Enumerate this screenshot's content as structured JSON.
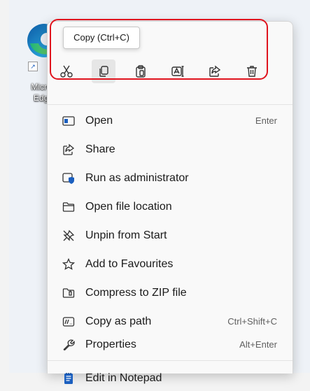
{
  "desktop": {
    "shortcut_label_line1": "Micros",
    "shortcut_label_line2": "Edge",
    "icon": "edge-icon"
  },
  "tooltip": {
    "text": "Copy (Ctrl+C)"
  },
  "quick_actions": [
    {
      "icon": "cut-icon",
      "name": "Cut"
    },
    {
      "icon": "copy-icon",
      "name": "Copy"
    },
    {
      "icon": "paste-icon",
      "name": "Paste"
    },
    {
      "icon": "rename-icon",
      "name": "Rename"
    },
    {
      "icon": "share-icon",
      "name": "Share"
    },
    {
      "icon": "delete-icon",
      "name": "Delete"
    }
  ],
  "menu": {
    "items": [
      {
        "label": "Open",
        "shortcut": "Enter",
        "icon": "open-icon"
      },
      {
        "label": "Share",
        "shortcut": "",
        "icon": "share-icon"
      },
      {
        "label": "Run as administrator",
        "shortcut": "",
        "icon": "shield-icon"
      },
      {
        "label": "Open file location",
        "shortcut": "",
        "icon": "folder-icon"
      },
      {
        "label": "Unpin from Start",
        "shortcut": "",
        "icon": "unpin-icon"
      },
      {
        "label": "Add to Favourites",
        "shortcut": "",
        "icon": "star-icon"
      },
      {
        "label": "Compress to ZIP file",
        "shortcut": "",
        "icon": "zip-icon"
      },
      {
        "label": "Copy as path",
        "shortcut": "Ctrl+Shift+C",
        "icon": "path-icon"
      },
      {
        "label": "Properties",
        "shortcut": "Alt+Enter",
        "icon": "wrench-icon"
      },
      {
        "label": "Edit in Notepad",
        "shortcut": "",
        "icon": "notepad-icon"
      }
    ]
  },
  "colors": {
    "highlight": "#e0141e",
    "accent": "#1b5fbf"
  }
}
